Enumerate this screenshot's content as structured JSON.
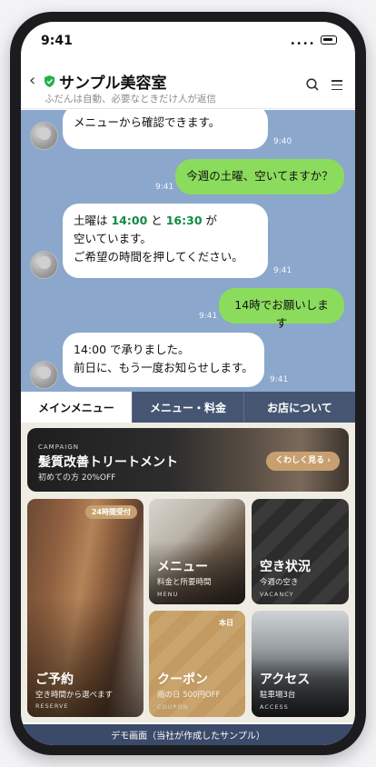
{
  "status_bar": {
    "time": "9:41",
    "signal": "••••"
  },
  "header": {
    "back_glyph": "‹",
    "title": "サンプル美容室",
    "subtitle": "ふだんは自動、必要なときだけ人が返信",
    "icons": [
      "back-icon",
      "verified-shield-icon",
      "search-icon",
      "hamburger-menu-icon"
    ],
    "accent_color": "#22b14c"
  },
  "chat": {
    "background_color": "#8ba7cb",
    "messages": [
      {
        "from": "shop",
        "lines": [
          "メニューから確認できます。"
        ],
        "time": "9:40"
      },
      {
        "from": "user",
        "lines": [
          "今週の土曜、空いてますか？"
        ],
        "time": "9:41"
      },
      {
        "from": "shop",
        "segments": {
          "pre": "土曜は ",
          "t1": "14:00",
          "mid": " と ",
          "t2": "16:30",
          "post": " が"
        },
        "lines": [
          "空いています。",
          "ご希望の時間を押してください。"
        ],
        "time": "9:41"
      },
      {
        "from": "user",
        "lines": [
          "14時でお願いします"
        ],
        "time": "9:41"
      },
      {
        "from": "shop",
        "lines": [
          "14:00 で承りました。",
          "前日に、もう一度お知らせします。"
        ],
        "time": "9:41"
      }
    ]
  },
  "tabs": [
    {
      "label": "メインメニュー",
      "active": true
    },
    {
      "label": "メニュー・料金",
      "active": false
    },
    {
      "label": "お店について",
      "active": false
    }
  ],
  "banner": {
    "kicker": "CAMPAIGN",
    "title": "髪質改善トリートメント",
    "subtitle": "初めての方 20%OFF",
    "button": "くわしく見る ›"
  },
  "cards": {
    "reserve": {
      "badge": "24時間受付",
      "title": "ご予約",
      "subtitle": "空き時間から選べます",
      "en": "RESERVE"
    },
    "menu": {
      "title": "メニュー",
      "subtitle": "料金と所要時間",
      "en": "MENU"
    },
    "vacancy": {
      "title": "空き状況",
      "subtitle": "今週の空き",
      "en": "VACANCY"
    },
    "coupon": {
      "badge": "本日",
      "title": "クーポン",
      "subtitle": "雨の日 500円OFF",
      "en": "COUPON"
    },
    "access": {
      "title": "アクセス",
      "subtitle": "駐車場3台",
      "en": "ACCESS"
    }
  },
  "footer": {
    "demo_label": "デモ画面（当社が作成したサンプル）"
  }
}
